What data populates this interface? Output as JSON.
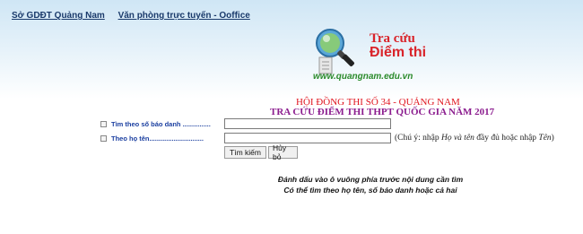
{
  "nav": {
    "link1": "Sở GDĐT Quảng Nam",
    "link2": "Văn phòng trực tuyến - Ooffice"
  },
  "logo": {
    "line1": "Tra cứu",
    "line2": "Điểm thi",
    "url": "www.quangnam.edu.vn"
  },
  "titles": {
    "line1": "HỘI ĐỒNG THI SỐ 34 - QUẢNG NAM",
    "line2": "TRA CỨU ĐIỂM THI THPT QUỐC GIA NĂM 2017"
  },
  "form": {
    "label_sbd": "Tìm theo số báo danh ...............",
    "label_name": "Theo họ tên.............................",
    "value_sbd": "",
    "value_name": "",
    "hint_prefix": "(Chú ý: nhập ",
    "hint_em1": "Họ và tên",
    "hint_suffix": " đầy đủ hoặc nhập ",
    "hint_em2": "Tên",
    "hint_close": ")",
    "btn_search": "Tìm kiếm",
    "btn_cancel": "Hủy bỏ"
  },
  "instructions": {
    "line1": "Đánh dấu vào ô vuông phía trước nội dung cần tìm",
    "line2": "Có thể tìm theo họ tên, số báo danh hoặc cả hai"
  }
}
